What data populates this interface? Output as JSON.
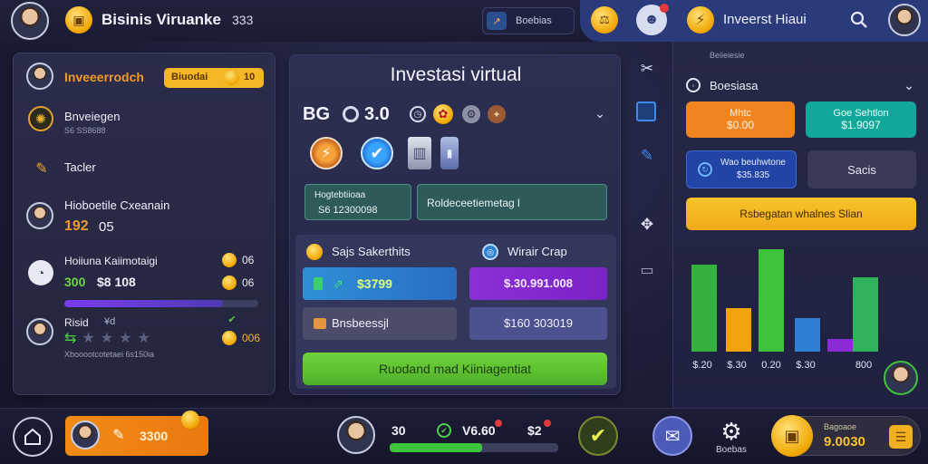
{
  "top_bar": {
    "title": "Bisinis Viruanke",
    "counter": "333",
    "search_placeholder": "Boebias",
    "investment_label": "Inveerst Hiaui"
  },
  "left_panel": {
    "header_title": "Inveeerrodch",
    "header_badge": "Biuodai",
    "header_badge_value": "10",
    "row1_title": "Bnveiegen",
    "row1_sub": "S6 SS8688",
    "row2_label": "Tacler",
    "row3_title": "Hioboetile Cxeanain",
    "row3_value_a": "192",
    "row3_value_b": "05",
    "row4_title": "Hoiiuna Kaiimotaigi",
    "row4_value_a": "300",
    "row4_value_b": "$8 108",
    "row4_coin_a": "06",
    "row4_coin_b": "06",
    "row4_progress": 0.82,
    "row5_title": "Risid",
    "row5_sub": "¥d",
    "row5_foot": "Xbooootcotetaei 6s150ia",
    "row5_coin": "006",
    "row5_rating": 1
  },
  "center_panel": {
    "title": "Investasi virtual",
    "stats_value_a": "BG",
    "stats_value_b": "3.0",
    "box1_label": "Hogtebtiioaa",
    "box1_value": "S6 12300098",
    "box2_label": "Roldeceetiemetag l",
    "sub_title_left": "Sajs Sakerthits",
    "sub_title_right": "Wirair Crap",
    "btn_blue_value": "$3799",
    "btn_purple_value": "$.30.991.008",
    "btn_grey_label": "Bnsbeessjl",
    "btn_slate_value": "$160 303019",
    "green_button": "Ruodand mad Kiiniagentiat"
  },
  "right_panel": {
    "header_top": "Beiieiesie",
    "header_title": "Boesiasa",
    "orange_btn_line1": "Mhtc",
    "orange_btn_line2": "$0.00",
    "teal_btn_line1": "Goe Sehtlon",
    "teal_btn_line2": "$1.9097",
    "blue_btn_text": "Wao beuhwtone\n$35.835",
    "grey_btn_text": "Sacis",
    "yellow_btn_text": "Rsbegatan whalnes Slian",
    "chart_colors": [
      "#37b13e",
      "#f2a20c",
      "#3fc23b",
      "#2f7fd6",
      "#8b2bd6",
      "#2fb25a"
    ]
  },
  "chart_data": {
    "type": "bar",
    "categories": [
      "$.20",
      "$.30",
      "$.30",
      "$.30",
      "",
      "$.00"
    ],
    "x_labels_shown": [
      "$.20",
      "$.30",
      "0.20",
      "$.30",
      "800"
    ],
    "values": [
      96,
      48,
      113,
      37,
      14,
      82
    ],
    "title": "",
    "xlabel": "",
    "ylabel": "",
    "grid": false
  },
  "bottom_bar": {
    "card_value": "3300",
    "player_level_a": "30",
    "player_level_b": "V6.60",
    "player_level_c": "$2",
    "xp_progress": 0.55,
    "settings_label": "Boebas",
    "gold_amount": "9.0030",
    "gold_label": "Bagoaoe"
  }
}
